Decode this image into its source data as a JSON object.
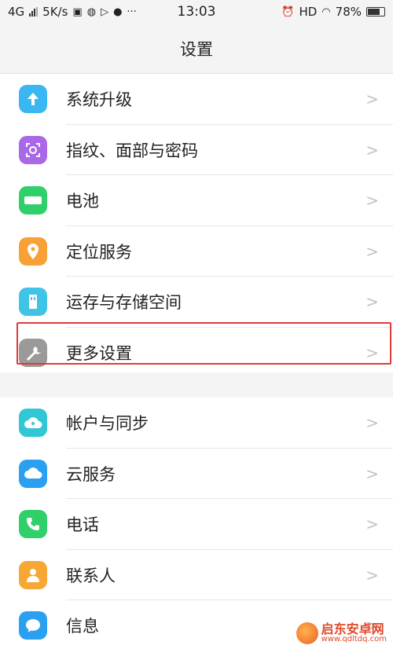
{
  "status": {
    "network": "4G",
    "speed": "5K/s",
    "time": "13:03",
    "hd": "HD",
    "battery": "78%"
  },
  "header": {
    "title": "设置"
  },
  "group1": [
    {
      "label": "系统升级",
      "icon": "system-update-icon",
      "color": "#3ab6f0"
    },
    {
      "label": "指纹、面部与密码",
      "icon": "fingerprint-face-icon",
      "color": "#a868e8"
    },
    {
      "label": "电池",
      "icon": "battery-icon",
      "color": "#2fcf6a"
    },
    {
      "label": "定位服务",
      "icon": "location-pin-icon",
      "color": "#f7a136"
    },
    {
      "label": "运存与存储空间",
      "icon": "storage-card-icon",
      "color": "#3fc4e6"
    },
    {
      "label": "更多设置",
      "icon": "wrench-icon",
      "color": "#9a9a9a"
    }
  ],
  "group2": [
    {
      "label": "帐户与同步",
      "icon": "account-sync-icon",
      "color": "#31c7d4"
    },
    {
      "label": "云服务",
      "icon": "cloud-icon",
      "color": "#2b9ff0"
    },
    {
      "label": "电话",
      "icon": "phone-icon",
      "color": "#2fcf6a"
    },
    {
      "label": "联系人",
      "icon": "contact-person-icon",
      "color": "#f7a736"
    },
    {
      "label": "信息",
      "icon": "message-icon",
      "color": "#2b9ff0"
    }
  ],
  "chevron": ">",
  "watermark": {
    "cn": "启东安卓网",
    "url": "www.qdltdq.com"
  }
}
